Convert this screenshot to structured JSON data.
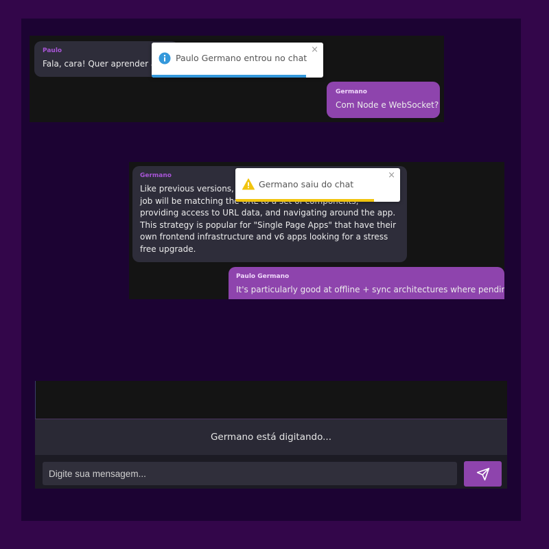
{
  "colors": {
    "page_background": "#33064a",
    "frame_background": "#1c0333",
    "panel_background": "#141414",
    "incoming_bubble": "#2e2d3a",
    "outgoing_bubble": "#8e44ad",
    "author_accent": "#a855d7",
    "info_color": "#3498db",
    "warning_color": "#f1c40f",
    "send_button": "#8e44ad"
  },
  "chat1": {
    "messages": [
      {
        "author": "Paulo",
        "text": "Fala, cara! Quer aprender a cr",
        "direction": "incoming"
      },
      {
        "author": "Germano",
        "text": "Com Node e WebSocket?",
        "direction": "outgoing"
      }
    ],
    "toast": {
      "type": "info",
      "icon": "info-circle-icon",
      "text": "Paulo Germano entrou no chat",
      "close": "×",
      "progress": 0.9
    }
  },
  "chat2": {
    "messages": [
      {
        "author": "Germano",
        "text": "Like previous versions, Rea declarative routing library. Its only job will be matching the URL to a set of components, providing access to URL data, and navigating around the app. This strategy is popular for \"Single Page Apps\" that have their own frontend infrastructure and v6 apps looking for a stress free upgrade.",
        "direction": "incoming"
      },
      {
        "author": "Paulo Germano",
        "text": "It's particularly good at offline + sync architectures where pending",
        "direction": "outgoing"
      }
    ],
    "toast": {
      "type": "warning",
      "icon": "warning-triangle-icon",
      "text": "Germano saiu do chat",
      "close": "×",
      "progress": 0.84
    }
  },
  "composer": {
    "typing_status": "Germano está digitando...",
    "placeholder": "Digite sua mensagem...",
    "send_icon": "send-icon"
  }
}
